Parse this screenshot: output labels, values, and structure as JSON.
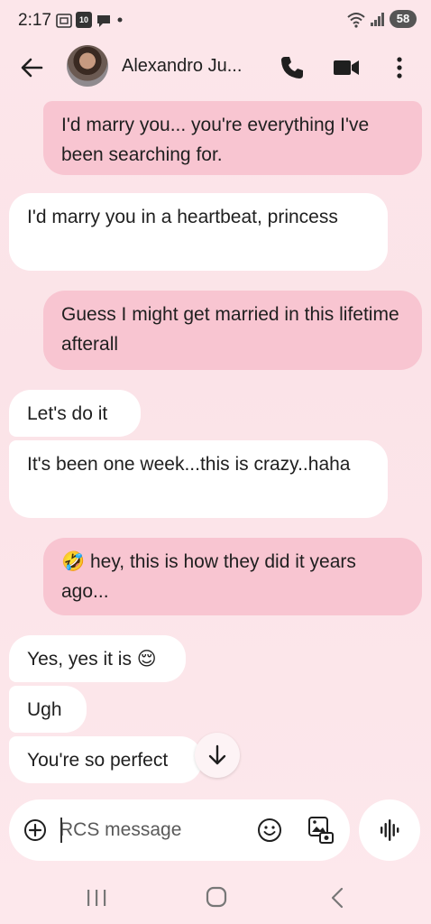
{
  "status_bar": {
    "time": "2:17",
    "notif_badge": "10",
    "battery": "58"
  },
  "header": {
    "contact_name": "Alexandro Ju...",
    "icons": [
      "back-arrow-icon",
      "phone-icon",
      "video-icon",
      "more-vert-icon"
    ]
  },
  "messages": [
    {
      "direction": "outgoing",
      "text": "I'd marry you... you're everything I've been searching for."
    },
    {
      "direction": "incoming",
      "text": "I'd marry you in a heartbeat, princess"
    },
    {
      "direction": "outgoing",
      "text": "Guess I might get married in this lifetime afterall"
    },
    {
      "direction": "incoming",
      "text": "Let's do it"
    },
    {
      "direction": "incoming",
      "text": "It's been one week...this is crazy..haha"
    },
    {
      "direction": "outgoing",
      "text": "🤣 hey, this is how they did it years ago..."
    },
    {
      "direction": "incoming",
      "text": "Yes, yes it is 😌"
    },
    {
      "direction": "incoming",
      "text": "Ugh"
    },
    {
      "direction": "incoming",
      "text": "You're so perfect"
    }
  ],
  "compose": {
    "placeholder": "RCS message"
  },
  "colors": {
    "outgoing_bubble": "#f8c5d1",
    "incoming_bubble": "#ffffff",
    "background": "#fce6ea"
  }
}
